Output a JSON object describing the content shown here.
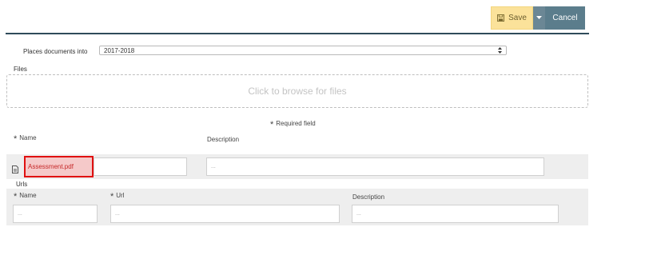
{
  "toolbar": {
    "save_label": "Save",
    "cancel_label": "Cancel",
    "colors": {
      "save_bg": "#fbe29a",
      "cancel_bg": "#5b7d8c",
      "rule": "#2f4b5a"
    }
  },
  "places": {
    "label": "Places documents into",
    "selected": "2017-2018"
  },
  "files": {
    "section_label": "Files",
    "dropzone_text": "Click to browse for files",
    "required_note": "Required field",
    "columns": {
      "name": "Name",
      "description": "Description"
    },
    "rows": [
      {
        "name": "Assessment.pdf",
        "description_placeholder": "..."
      }
    ]
  },
  "urls": {
    "section_label": "Urls",
    "columns": {
      "name": "Name",
      "url": "Url",
      "description": "Description"
    },
    "placeholders": {
      "name": "...",
      "url": "...",
      "description": "..."
    }
  },
  "icons": {
    "save": "floppy-disk-icon",
    "caret": "caret-down-icon",
    "select": "up-down-arrows-icon",
    "file": "file-document-icon",
    "required": "asterisk-icon"
  }
}
